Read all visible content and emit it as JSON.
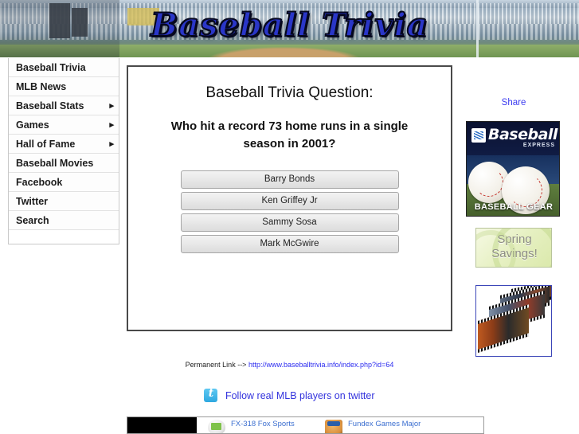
{
  "site": {
    "banner_title": "Baseball Trivia"
  },
  "nav": {
    "items": [
      {
        "label": "Baseball Trivia",
        "has_submenu": false,
        "arrow": ""
      },
      {
        "label": "MLB News",
        "has_submenu": false,
        "arrow": ""
      },
      {
        "label": "Baseball Stats",
        "has_submenu": true,
        "arrow": "▸"
      },
      {
        "label": "Games",
        "has_submenu": true,
        "arrow": "▸"
      },
      {
        "label": "Hall of Fame",
        "has_submenu": true,
        "arrow": "▸"
      },
      {
        "label": "Baseball Movies",
        "has_submenu": false,
        "arrow": ""
      },
      {
        "label": "Facebook",
        "has_submenu": false,
        "arrow": ""
      },
      {
        "label": "Twitter",
        "has_submenu": false,
        "arrow": ""
      },
      {
        "label": "Search",
        "has_submenu": false,
        "arrow": ""
      }
    ]
  },
  "quiz": {
    "title": "Baseball Trivia Question:",
    "question": "Who hit a record 73 home runs in a single season in 2001?",
    "answers": [
      "Barry Bonds",
      "Ken Griffey Jr",
      "Sammy Sosa",
      "Mark McGwire"
    ]
  },
  "permalink": {
    "prefix": "Permanent Link -->",
    "url": "http://www.baseballtrivia.info/index.php?id=64"
  },
  "twitter": {
    "icon": "twitter-bird-icon",
    "text": "Follow real MLB players on twitter"
  },
  "right_column": {
    "share_label": "Share",
    "ad_baseball": {
      "logo_word": "Baseball",
      "logo_sub": "EXPRESS",
      "caption": "BASEBALL GEAR"
    },
    "ad_spring": {
      "line1": "Spring",
      "line2": "Savings!"
    },
    "ad_film": {
      "alt": "film-strip-montage"
    }
  },
  "products": [
    {
      "name": "FX-318 Fox Sports",
      "thumb": "handheld-game-thumb"
    },
    {
      "name": "Fundex Games Major",
      "thumb": "board-game-thumb"
    }
  ],
  "colors": {
    "link_blue": "#3333dd",
    "share_blue": "#3c3cf0",
    "permalink_blue": "#2d2df0",
    "banner_title_blue": "#2a36c8",
    "panel_border": "#4a4a4a",
    "product_link_blue": "#3c6fd0"
  }
}
